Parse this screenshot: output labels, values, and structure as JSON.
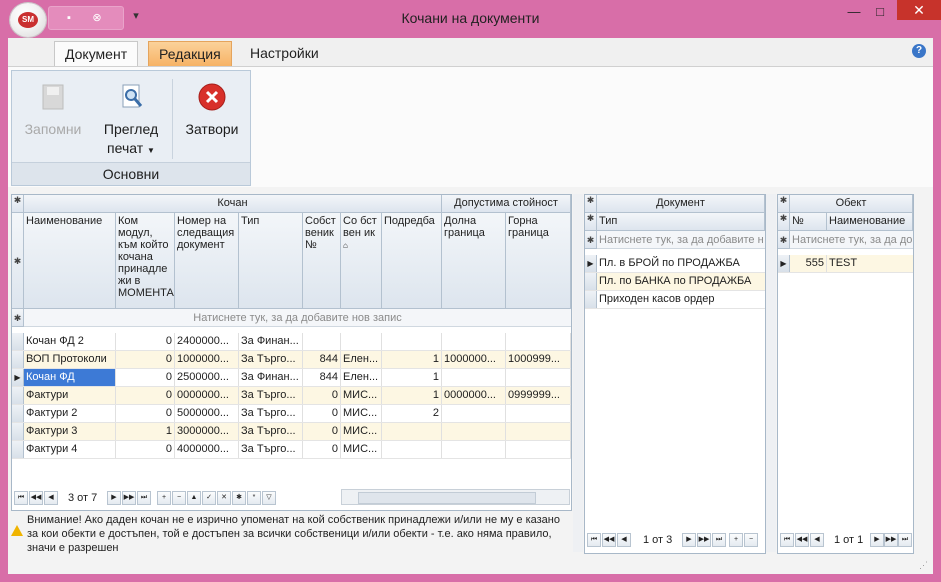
{
  "window": {
    "title": "Кочани на документи",
    "logo_text": "SM",
    "minimize": "—",
    "maximize": "□",
    "close": "✕"
  },
  "tabs": [
    {
      "label": "Документ"
    },
    {
      "label": "Редакция"
    },
    {
      "label": "Настройки"
    }
  ],
  "help_label": "?",
  "ribbon": {
    "group_label": "Основни",
    "save_label": "Запомни",
    "preview_label_1": "Преглед",
    "preview_label_2": "печат",
    "close_label": "Затвори"
  },
  "main_grid": {
    "band_kochan": "Кочан",
    "band_allowed": "Допустима стойност",
    "headers": [
      "Наименование",
      "Ком модул, към който кочана принадле жи в МОМЕНТА",
      "Номер на следващия документ",
      "Тип",
      "Собст веник №",
      "Со бст вен ик",
      "Подредба",
      "Долна граница",
      "Горна граница"
    ],
    "new_row": "Натиснете тук, за да добавите нов запис",
    "rows": [
      [
        "Кочан ФД 2",
        "0",
        "2400000...",
        "За Финан...",
        "",
        "",
        "",
        "",
        ""
      ],
      [
        "ВОП Протоколи",
        "0",
        "1000000...",
        "За Търго...",
        "844",
        "Елен...",
        "1",
        "1000000...",
        "1000999..."
      ],
      [
        "Кочан ФД",
        "0",
        "2500000...",
        "За Финан...",
        "844",
        "Елен...",
        "1",
        "",
        ""
      ],
      [
        "Фактури",
        "0",
        "0000000...",
        "За Търго...",
        "0",
        "МИС...",
        "1",
        "0000000...",
        "0999999..."
      ],
      [
        "Фактури 2",
        "0",
        "5000000...",
        "За Търго...",
        "0",
        "МИС...",
        "2",
        "",
        ""
      ],
      [
        "Фактури 3",
        "1",
        "3000000...",
        "За Търго...",
        "0",
        "МИС...",
        "",
        "",
        ""
      ],
      [
        "Фактури 4",
        "0",
        "4000000...",
        "За Търго...",
        "0",
        "МИС...",
        "",
        "",
        ""
      ]
    ],
    "pager": "3 от 7"
  },
  "warning": "Внимание! Ако даден кочан не е изрично упоменат на кой собственик принадлежи и/или не му е казано за кои обекти е достъпен, той е достъпен за всички собственици и/или обекти - т.е. ако няма правило, значи е разрешен",
  "doc_grid": {
    "band": "Документ",
    "header": "Тип",
    "new_row": "Натиснете тук, за да добавите н",
    "rows": [
      "Пл. в БРОЙ по ПРОДАЖБА",
      "Пл. по БАНКА по ПРОДАЖБА",
      "Приходен касов ордер"
    ],
    "pager": "1 от 3"
  },
  "obj_grid": {
    "band": "Обект",
    "headers": [
      "№",
      "Наименование"
    ],
    "new_row": "Натиснете тук, за да до",
    "rows": [
      [
        "555",
        "TEST"
      ]
    ],
    "pager": "1 от 1"
  },
  "colors": {
    "accent": "#d86ea8",
    "selection": "#3d7ad6",
    "alt_row": "#fdf7e3"
  }
}
